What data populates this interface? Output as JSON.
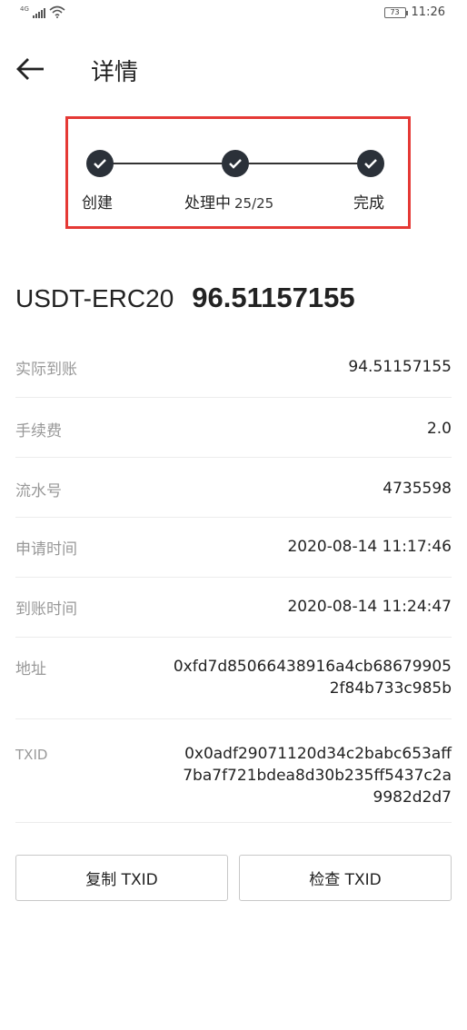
{
  "status_bar": {
    "network": "4G",
    "battery": "73",
    "time": "11:26"
  },
  "header": {
    "title": "详情",
    "back_icon": "arrow-left-icon"
  },
  "progress": {
    "steps": [
      {
        "label": "创建",
        "icon": "check-icon"
      },
      {
        "label": "处理中",
        "count": "25/25",
        "icon": "check-icon"
      },
      {
        "label": "完成",
        "icon": "check-icon"
      }
    ],
    "highlight_color": "#e53935",
    "dot_color": "#2b3139"
  },
  "summary": {
    "coin": "USDT-ERC20",
    "amount": "96.51157155"
  },
  "details": [
    {
      "label": "实际到账",
      "value": "94.51157155"
    },
    {
      "label": "手续费",
      "value": "2.0"
    },
    {
      "label": "流水号",
      "value": "4735598"
    },
    {
      "label": "申请时间",
      "value": "2020-08-14 11:17:46"
    },
    {
      "label": "到账时间",
      "value": "2020-08-14 11:24:47"
    },
    {
      "label": "地址",
      "value": "0xfd7d85066438916a4cb68679905 2f84b733c985b"
    },
    {
      "label": "TXID",
      "value": "0x0adf29071120d34c2babc653aff 7ba7f721bdea8d30b235ff5437c2a 9982d2d7"
    }
  ],
  "buttons": {
    "copy": "复制 TXID",
    "check": "检查 TXID"
  }
}
